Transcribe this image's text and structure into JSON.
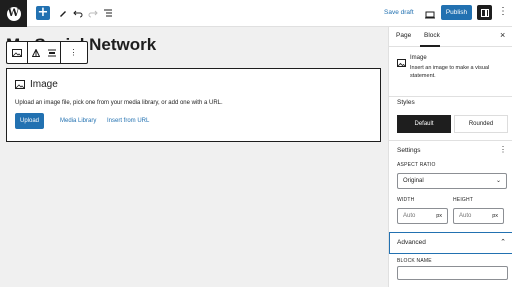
{
  "toolbar": {
    "save_draft": "Save draft",
    "publish": "Publish",
    "add_label": "+"
  },
  "page": {
    "title": "My Social Network"
  },
  "image_block": {
    "title": "Image",
    "description": "Upload an image file, pick one from your media library, or add one with a URL.",
    "upload": "Upload",
    "media_library": "Media Library",
    "insert_url": "Insert from URL"
  },
  "sidebar": {
    "tabs": [
      "Page",
      "Block"
    ],
    "active_tab": "Block",
    "block_title": "Image",
    "block_desc": "Insert an image to make a visual statement.",
    "styles_heading": "Styles",
    "styles": [
      "Default",
      "Rounded"
    ],
    "settings_heading": "Settings",
    "aspect_ratio_label": "ASPECT RATIO",
    "aspect_ratio_value": "Original",
    "width_label": "WIDTH",
    "height_label": "HEIGHT",
    "width_placeholder": "Auto",
    "height_placeholder": "Auto",
    "unit": "px",
    "advanced_heading": "Advanced",
    "block_name_label": "BLOCK NAME"
  },
  "colors": {
    "accent": "#2271b1",
    "dark": "#1e1e1e"
  }
}
